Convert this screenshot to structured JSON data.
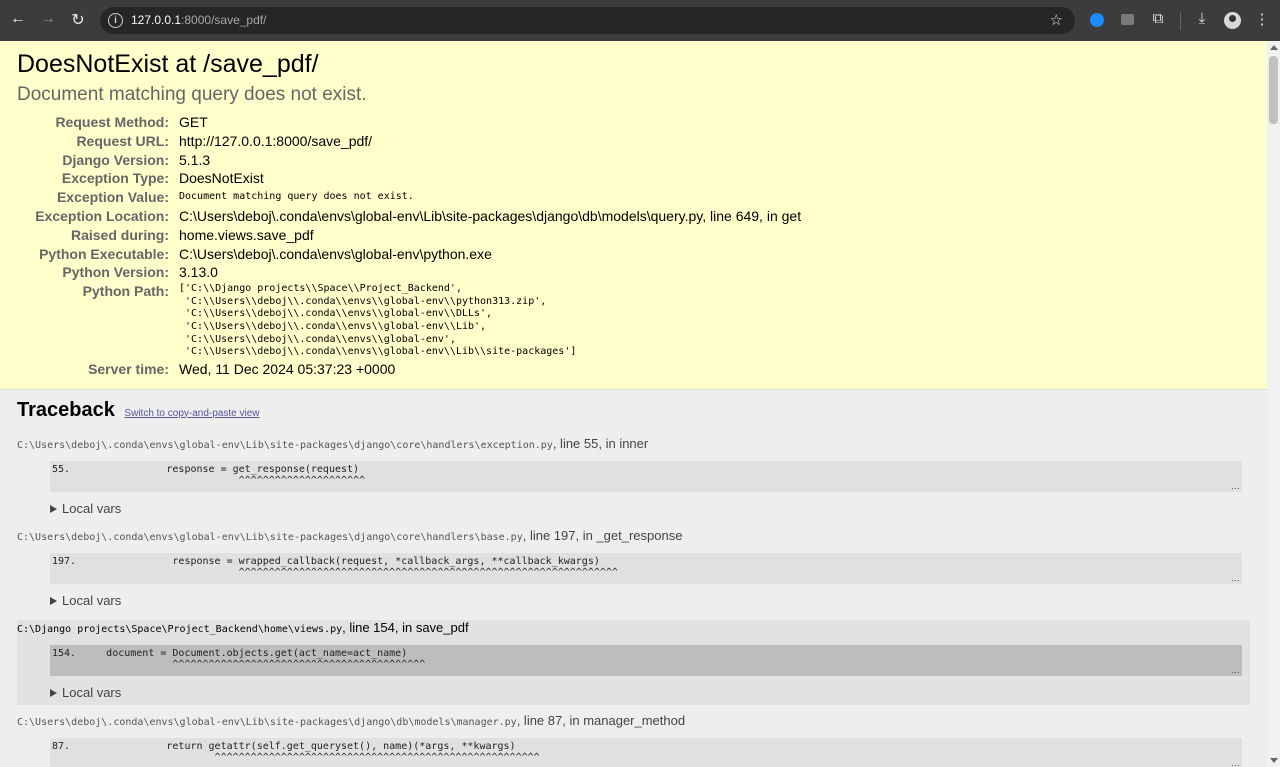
{
  "browser": {
    "url_host": "127.0.0.1",
    "url_rest": ":8000/save_pdf/"
  },
  "summary": {
    "title": "DoesNotExist at /save_pdf/",
    "subtitle": "Document matching query does not exist.",
    "rows": [
      {
        "label": "Request Method:",
        "value": "GET"
      },
      {
        "label": "Request URL:",
        "value": "http://127.0.0.1:8000/save_pdf/"
      },
      {
        "label": "Django Version:",
        "value": "5.1.3"
      },
      {
        "label": "Exception Type:",
        "value": "DoesNotExist"
      },
      {
        "label": "Exception Value:",
        "value": "Document matching query does not exist."
      },
      {
        "label": "Exception Location:",
        "value": "C:\\Users\\deboj\\.conda\\envs\\global-env\\Lib\\site-packages\\django\\db\\models\\query.py, line 649, in get"
      },
      {
        "label": "Raised during:",
        "value": "home.views.save_pdf"
      },
      {
        "label": "Python Executable:",
        "value": "C:\\Users\\deboj\\.conda\\envs\\global-env\\python.exe"
      },
      {
        "label": "Python Version:",
        "value": "3.13.0"
      },
      {
        "label": "Python Path:",
        "value": "['C:\\\\Django projects\\\\Space\\\\Project_Backend',\n 'C:\\\\Users\\\\deboj\\\\.conda\\\\envs\\\\global-env\\\\python313.zip',\n 'C:\\\\Users\\\\deboj\\\\.conda\\\\envs\\\\global-env\\\\DLLs',\n 'C:\\\\Users\\\\deboj\\\\.conda\\\\envs\\\\global-env\\\\Lib',\n 'C:\\\\Users\\\\deboj\\\\.conda\\\\envs\\\\global-env',\n 'C:\\\\Users\\\\deboj\\\\.conda\\\\envs\\\\global-env\\\\Lib\\\\site-packages']"
      },
      {
        "label": "Server time:",
        "value": "Wed, 11 Dec 2024 05:37:23 +0000"
      }
    ]
  },
  "traceback": {
    "title": "Traceback",
    "switch_link": "Switch to copy-and-paste view",
    "local_vars_label": "Local vars",
    "ellipsis": "…",
    "frames": [
      {
        "path": "C:\\Users\\deboj\\.conda\\envs\\global-env\\Lib\\site-packages\\django\\core\\handlers\\exception.py",
        "where": ", line 55, in inner",
        "code": "55.                response = get_response(request)\n                               ^^^^^^^^^^^^^^^^^^^^^"
      },
      {
        "path": "C:\\Users\\deboj\\.conda\\envs\\global-env\\Lib\\site-packages\\django\\core\\handlers\\base.py",
        "where": ", line 197, in _get_response",
        "code": "197.                response = wrapped_callback(request, *callback_args, **callback_kwargs)\n                               ^^^^^^^^^^^^^^^^^^^^^^^^^^^^^^^^^^^^^^^^^^^^^^^^^^^^^^^^^^^^^^^"
      },
      {
        "path": "C:\\Django projects\\Space\\Project_Backend\\home\\views.py",
        "where": ", line 154, in save_pdf",
        "code": "154.     document = Document.objects.get(act_name=act_name)\n                    ^^^^^^^^^^^^^^^^^^^^^^^^^^^^^^^^^^^^^^^^^^"
      },
      {
        "path": "C:\\Users\\deboj\\.conda\\envs\\global-env\\Lib\\site-packages\\django\\db\\models\\manager.py",
        "where": ", line 87, in manager_method",
        "code": "87.                return getattr(self.get_queryset(), name)(*args, **kwargs)\n                           ^^^^^^^^^^^^^^^^^^^^^^^^^^^^^^^^^^^^^^^^^^^^^^^^^^^^^^"
      }
    ]
  }
}
